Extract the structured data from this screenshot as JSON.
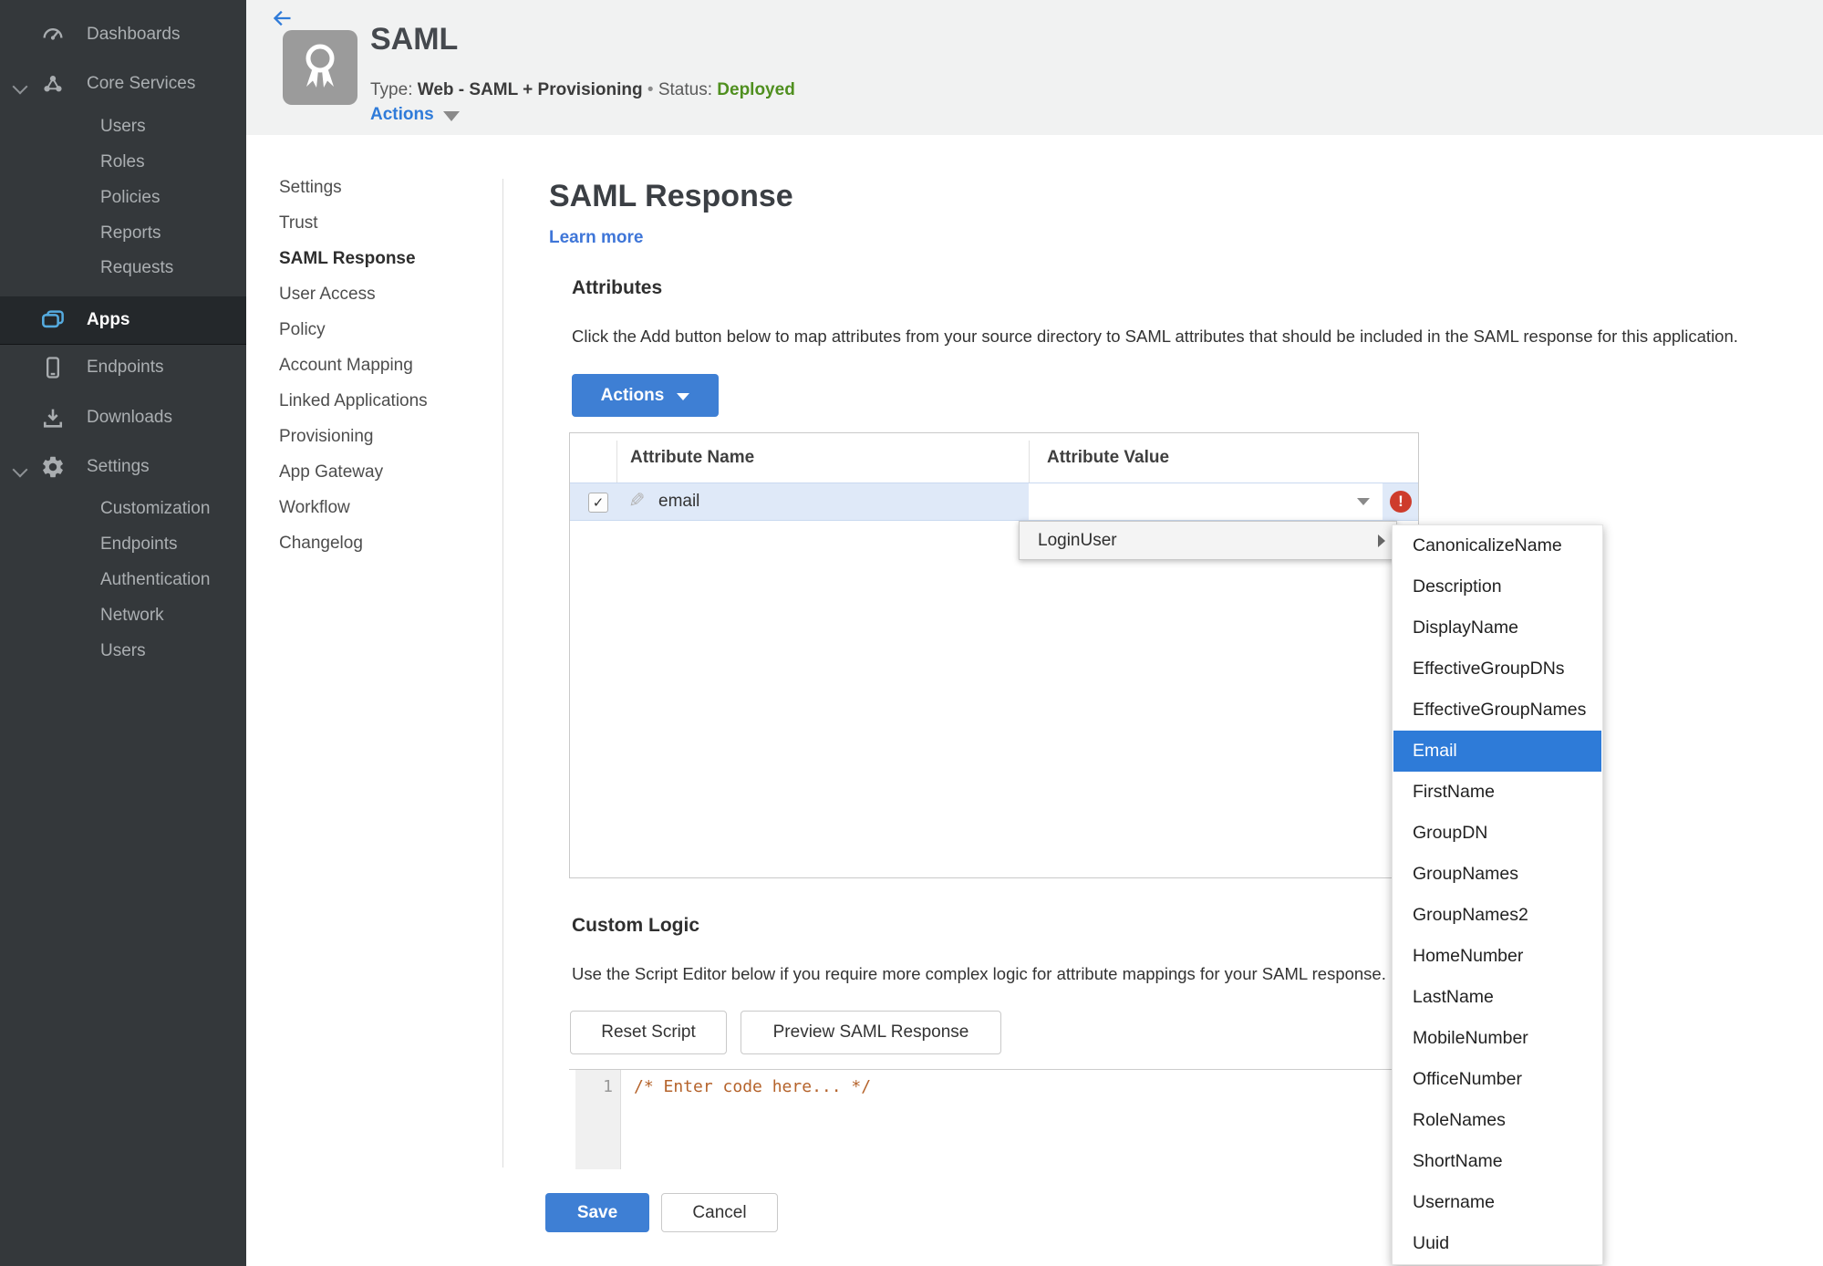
{
  "sidebar": {
    "items": [
      {
        "label": "Dashboards",
        "icon": "gauge-icon"
      },
      {
        "label": "Core Services",
        "icon": "core-services-icon",
        "expanded": true
      },
      {
        "label": "Users"
      },
      {
        "label": "Roles"
      },
      {
        "label": "Policies"
      },
      {
        "label": "Reports"
      },
      {
        "label": "Requests"
      },
      {
        "label": "Apps",
        "icon": "apps-icon",
        "active": true
      },
      {
        "label": "Endpoints",
        "icon": "device-icon"
      },
      {
        "label": "Downloads",
        "icon": "download-icon"
      },
      {
        "label": "Settings",
        "icon": "gear-icon",
        "expanded": true
      },
      {
        "label": "Customization"
      },
      {
        "label": "Endpoints"
      },
      {
        "label": "Authentication"
      },
      {
        "label": "Network"
      },
      {
        "label": "Users"
      }
    ]
  },
  "header": {
    "app_name": "SAML",
    "type_label": "Type:",
    "type_value": "Web - SAML + Provisioning",
    "dot": "•",
    "status_label": "Status:",
    "status_value": "Deployed",
    "actions_label": "Actions"
  },
  "subnav": {
    "items": [
      "Settings",
      "Trust",
      "SAML Response",
      "User Access",
      "Policy",
      "Account Mapping",
      "Linked Applications",
      "Provisioning",
      "App Gateway",
      "Workflow",
      "Changelog"
    ],
    "active": "SAML Response"
  },
  "main": {
    "title": "SAML Response",
    "learn_more": "Learn more",
    "attributes": {
      "heading": "Attributes",
      "description": "Click the Add button below to map attributes from your source directory to SAML attributes that should be included in the SAML response for this application.",
      "actions_button": "Actions",
      "table": {
        "columns": [
          "Attribute Name",
          "Attribute Value"
        ],
        "row": {
          "name": "email",
          "checked": true,
          "value": "",
          "error": true
        }
      }
    },
    "value_menu": {
      "parent": "LoginUser",
      "selected": "Email",
      "options": [
        "CanonicalizeName",
        "Description",
        "DisplayName",
        "EffectiveGroupDNs",
        "EffectiveGroupNames",
        "Email",
        "FirstName",
        "GroupDN",
        "GroupNames",
        "GroupNames2",
        "HomeNumber",
        "LastName",
        "MobileNumber",
        "OfficeNumber",
        "RoleNames",
        "ShortName",
        "Username",
        "Uuid"
      ]
    },
    "custom_logic": {
      "heading": "Custom Logic",
      "description": "Use the Script Editor below if you require more complex logic for attribute mappings for your SAML response.",
      "reset_button": "Reset Script",
      "preview_button": "Preview SAML Response",
      "editor": {
        "line_number": "1",
        "code": "/* Enter code here... */"
      }
    },
    "footer": {
      "save": "Save",
      "cancel": "Cancel"
    }
  },
  "glyphs": {
    "check": "✓",
    "error": "!",
    "pencil": "✎"
  },
  "colors": {
    "accent_blue": "#3e7fd4",
    "link_blue": "#2f7bd9",
    "menu_highlight": "#2e7bd8",
    "status_green": "#4f8f1f",
    "error_red": "#ce3c2c",
    "comment_orange": "#b5632b",
    "sidebar_bg": "#34383b",
    "sidebar_icon_blue": "#55abdf",
    "header_bg": "#f1f2f2",
    "row_highlight": "#dfe9f8"
  }
}
